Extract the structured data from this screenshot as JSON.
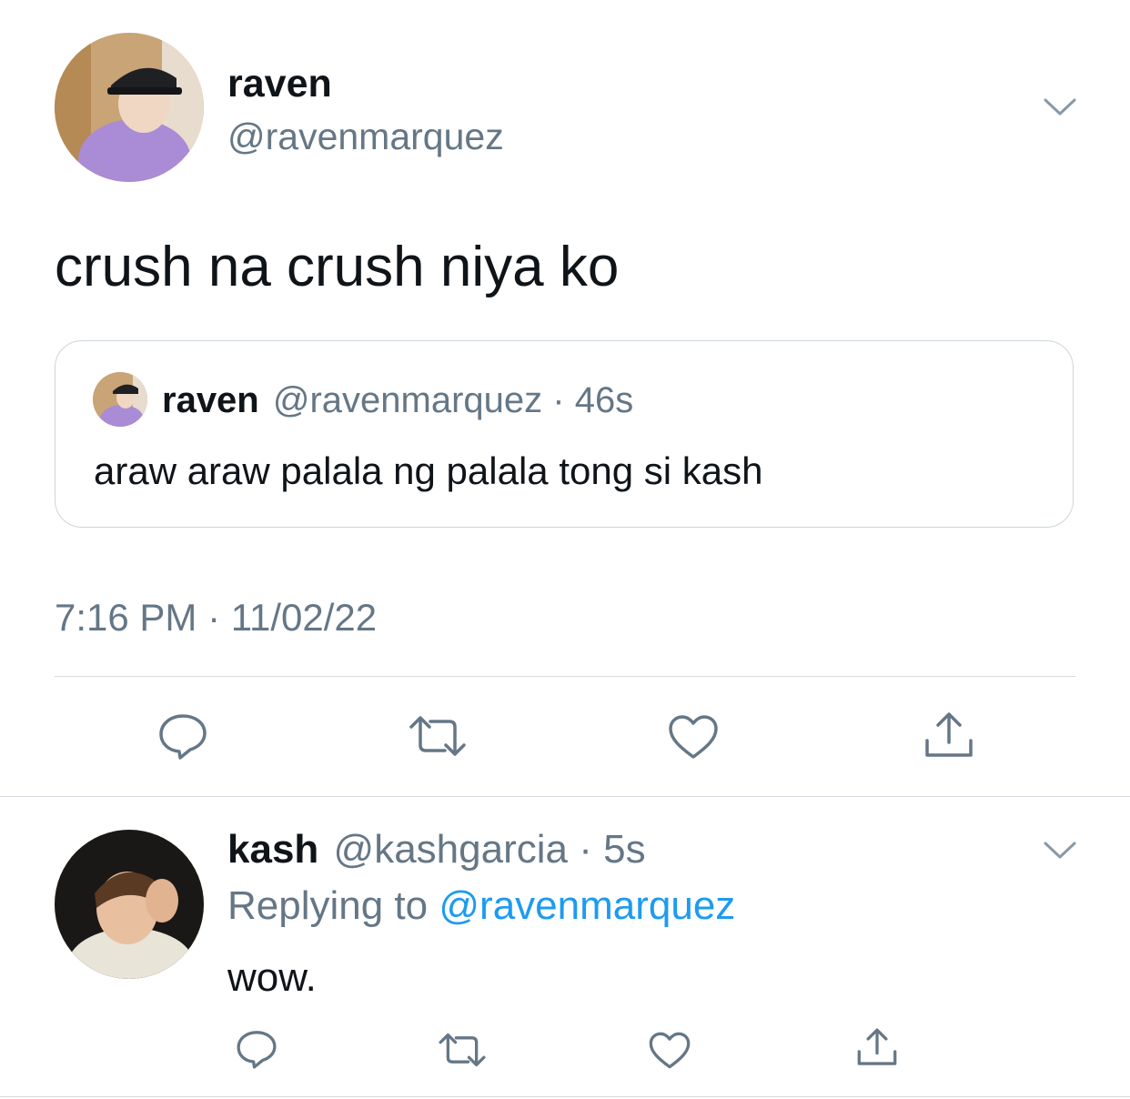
{
  "main_tweet": {
    "display_name": "raven",
    "handle": "@ravenmarquez",
    "text": "crush na crush niya ko",
    "timestamp": "7:16 PM · 11/02/22"
  },
  "quoted_tweet": {
    "display_name": "raven",
    "handle": "@ravenmarquez",
    "time": "· 46s",
    "text": "araw araw palala ng palala tong si kash"
  },
  "reply_tweet": {
    "display_name": "kash",
    "handle": "@kashgarcia",
    "time": "· 5s",
    "replying_prefix": "Replying to",
    "replying_handle": "@ravenmarquez",
    "text": "wow."
  },
  "icons": [
    "chevron-down-icon",
    "reply-icon",
    "retweet-icon",
    "like-icon",
    "share-icon"
  ],
  "colors": {
    "text": "#0f1419",
    "muted": "#657786",
    "link": "#1d9bf0",
    "border": "#d6dbdf"
  }
}
